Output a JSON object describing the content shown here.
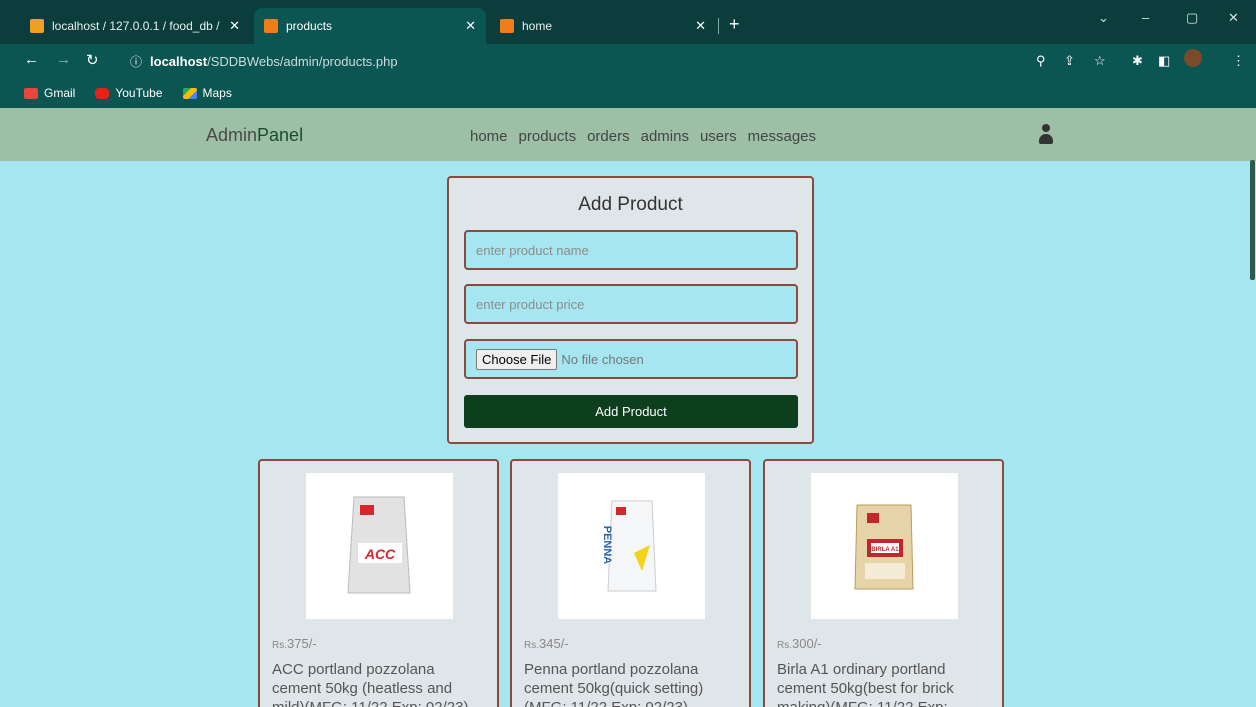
{
  "browser": {
    "tabs": [
      {
        "title": "localhost / 127.0.0.1 / food_db / ",
        "close": "✕",
        "active": false
      },
      {
        "title": "products",
        "close": "✕",
        "active": true
      },
      {
        "title": "home",
        "close": "✕",
        "active": false
      }
    ],
    "new_tab": "+",
    "url_host": "localhost",
    "url_path": "/SDDBWebs/admin/products.php",
    "bookmarks": [
      "Gmail",
      "YouTube",
      "Maps"
    ]
  },
  "header": {
    "logo_admin": "Admin",
    "logo_panel": "Panel",
    "nav": [
      "home",
      "products",
      "orders",
      "admins",
      "users",
      "messages"
    ]
  },
  "form": {
    "title": "Add Product",
    "name_placeholder": "enter product name",
    "price_placeholder": "enter product price",
    "choose_file": "Choose File",
    "no_file": "No file chosen",
    "submit": "Add Product"
  },
  "products": [
    {
      "currency": "Rs.",
      "price": "375/-",
      "name": "ACC portland pozzolana cement 50kg (heatless and mild)(MFG: 11/22 Exp: 02/23)",
      "brand": "ACC",
      "bag_color": "#e8e8e8",
      "accent": "#d8262c"
    },
    {
      "currency": "Rs.",
      "price": "345/-",
      "name": "Penna portland pozzolana cement 50kg(quick setting) (MFG: 11/22 Exp: 02/23)",
      "brand": "PENNA",
      "bag_color": "#f2f4f6",
      "accent": "#2a66a8"
    },
    {
      "currency": "Rs.",
      "price": "300/-",
      "name": "Birla A1 ordinary portland cement 50kg(best for brick making)(MFG: 11/22 Exp:",
      "brand": "BIRLA A1",
      "bag_color": "#e6d3a8",
      "accent": "#c2262c"
    }
  ]
}
